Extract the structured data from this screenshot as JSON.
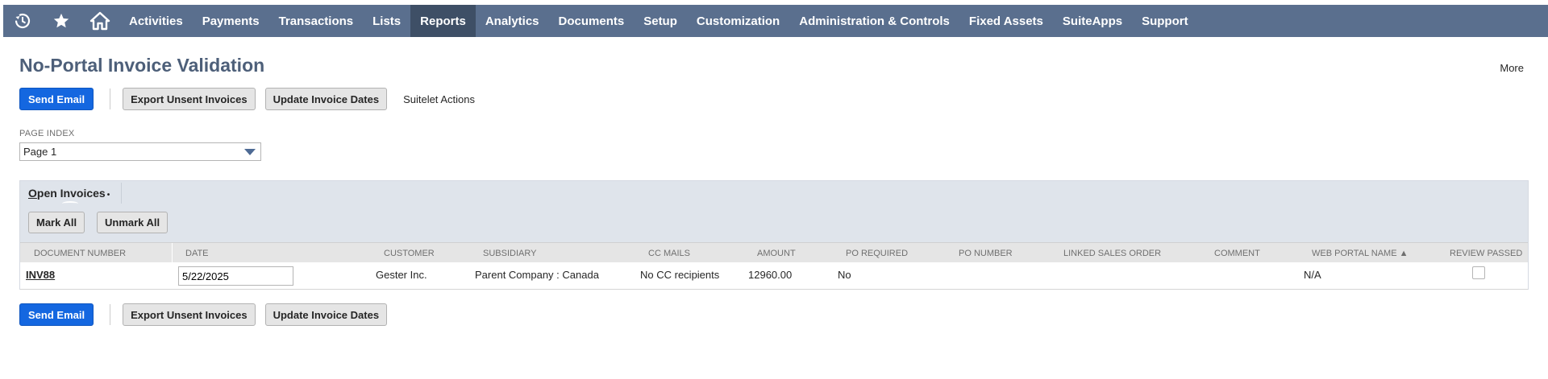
{
  "nav": {
    "icons": [
      "recent-icon",
      "star-icon",
      "home-icon"
    ],
    "items": [
      {
        "label": "Activities"
      },
      {
        "label": "Payments"
      },
      {
        "label": "Transactions"
      },
      {
        "label": "Lists"
      },
      {
        "label": "Reports",
        "active": true
      },
      {
        "label": "Analytics"
      },
      {
        "label": "Documents"
      },
      {
        "label": "Setup"
      },
      {
        "label": "Customization"
      },
      {
        "label": "Administration & Controls"
      },
      {
        "label": "Fixed Assets"
      },
      {
        "label": "SuiteApps"
      },
      {
        "label": "Support"
      }
    ]
  },
  "page": {
    "title": "No-Portal Invoice Validation",
    "more": "More"
  },
  "actions": {
    "send_email": "Send Email",
    "export_unsent": "Export Unsent Invoices",
    "update_dates": "Update Invoice Dates",
    "suitelet_actions": "Suitelet Actions"
  },
  "page_index": {
    "label": "PAGE INDEX",
    "selected": "Page 1"
  },
  "sublist": {
    "tab_label_underlined": "O",
    "tab_label_rest": "pen Invoices",
    "tab_bullet": "•",
    "mark_all": "Mark All",
    "unmark_all": "Unmark All",
    "columns": {
      "document_number": "DOCUMENT NUMBER",
      "date": "DATE",
      "customer": "CUSTOMER",
      "subsidiary": "SUBSIDIARY",
      "cc_mails": "CC MAILS",
      "amount": "AMOUNT",
      "po_required": "PO REQUIRED",
      "po_number": "PO NUMBER",
      "linked_sales_order": "LINKED SALES ORDER",
      "comment": "COMMENT",
      "web_portal_name": "WEB PORTAL NAME ▲",
      "review_passed": "REVIEW PASSED"
    },
    "rows": [
      {
        "document_number": "INV88",
        "date": "5/22/2025",
        "customer": "Gester Inc.",
        "subsidiary": "Parent Company : Canada",
        "cc_mails": "No CC recipients",
        "amount": "12960.00",
        "po_required": "No",
        "po_number": "",
        "linked_sales_order": "",
        "comment": "",
        "web_portal_name": "N/A",
        "review_passed": false
      }
    ]
  },
  "colors": {
    "nav_bg": "#5a6f8e",
    "nav_active": "#3e4f66",
    "primary_button": "#1467e0",
    "title": "#4d5f79",
    "sublist_bg": "#dfe4eb"
  }
}
